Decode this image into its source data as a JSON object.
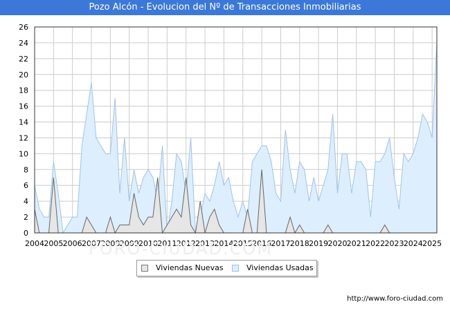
{
  "header": {
    "title": "Pozo Alcón - Evolucion del Nº de Transacciones Inmobiliarias"
  },
  "footer": {
    "url": "http://www.foro-ciudad.com"
  },
  "watermark": {
    "text": "FORO-CIUDAD.COM"
  },
  "colors": {
    "title_bg": "#3c78d8",
    "usadas_fill": "#ddeeff",
    "usadas_line": "#9ec3e8",
    "nuevas_fill": "#e6e6e6",
    "nuevas_line": "#666666",
    "grid": "#cccccc"
  },
  "chart_data": {
    "type": "area",
    "title": "Pozo Alcón - Evolucion del Nº de Transacciones Inmobiliarias",
    "x_ticks": [
      "2004",
      "2005",
      "2006",
      "2007",
      "2008",
      "2009",
      "2010",
      "2011",
      "2012",
      "2013",
      "2014",
      "2015",
      "2016",
      "2017",
      "2018",
      "2019",
      "2020",
      "2021",
      "2022",
      "2023",
      "2024",
      "2025"
    ],
    "ylim": [
      0,
      26
    ],
    "y_ticks": [
      0,
      2,
      4,
      6,
      8,
      10,
      12,
      14,
      16,
      18,
      20,
      22,
      24,
      26
    ],
    "x_start": 2004,
    "x_end": 2025.25,
    "grid": true,
    "legend_position": "bottom-center",
    "series": [
      {
        "name": "Viviendas Nuevas",
        "style": "nuevas",
        "values": [
          3,
          0,
          0,
          0,
          7,
          0,
          0,
          0,
          0,
          0,
          0,
          2,
          1,
          0,
          0,
          0,
          2,
          0,
          1,
          1,
          1,
          5,
          2,
          1,
          2,
          2,
          7,
          0,
          1,
          2,
          3,
          2,
          7,
          1,
          0,
          4,
          0,
          2,
          3,
          1,
          0,
          0,
          0,
          0,
          0,
          3,
          0,
          0,
          8,
          0,
          0,
          0,
          0,
          0,
          2,
          0,
          1,
          0,
          0,
          0,
          0,
          0,
          1,
          0,
          0,
          0,
          0,
          0,
          0,
          0,
          0,
          0,
          0,
          0,
          1,
          0,
          0,
          0,
          0,
          0,
          0,
          0,
          0,
          0,
          0,
          0
        ]
      },
      {
        "name": "Viviendas Usadas",
        "style": "usadas",
        "values": [
          6,
          3,
          2,
          2,
          9,
          5,
          0,
          1,
          2,
          2,
          11,
          15,
          19,
          12,
          11,
          10,
          10,
          17,
          5,
          12,
          4,
          8,
          5,
          7,
          8,
          7,
          4,
          11,
          0,
          4,
          10,
          9,
          5,
          12,
          0,
          2,
          5,
          4,
          6,
          9,
          6,
          7,
          4,
          2,
          4,
          2,
          9,
          10,
          11,
          11,
          9,
          5,
          4,
          13,
          8,
          5,
          9,
          8,
          4,
          7,
          4,
          6,
          8,
          15,
          5,
          10,
          10,
          5,
          9,
          9,
          8,
          2,
          9,
          9,
          10,
          12,
          7,
          3,
          10,
          9,
          10,
          12,
          15,
          14,
          12,
          24
        ]
      }
    ]
  }
}
